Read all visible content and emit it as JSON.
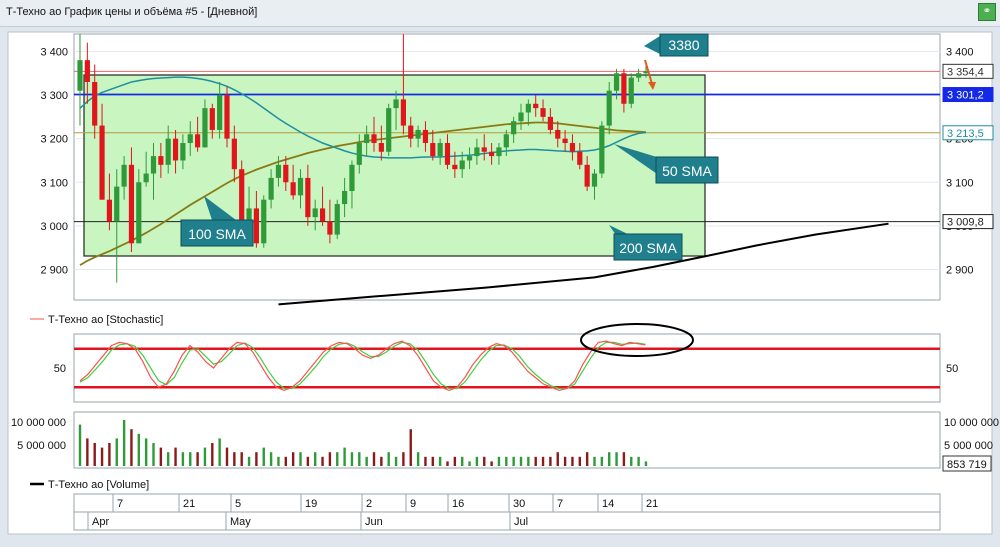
{
  "window": {
    "title": "Т-Техно ао График цены и объёма #5 - [Дневной]"
  },
  "colors": {
    "up": "#2f9a3a",
    "down": "#e0161c",
    "sma50": "#1e8fa0",
    "sma100": "#8a7a14",
    "sma200": "#000000",
    "level": "#1428e8",
    "box": "#c8f5c0",
    "stoch_k": "#ff5050",
    "stoch_d": "#3fcf3f",
    "callout": "#1f7f8c"
  },
  "price_axis": {
    "ticks": [
      "3 400",
      "3 300",
      "3 200",
      "3 100",
      "3 000",
      "2 900"
    ],
    "values": [
      3400,
      3300,
      3200,
      3100,
      3000,
      2900
    ],
    "labels": {
      "close": "3 354,4",
      "level": "3 301,2",
      "sma50": "3 213,5",
      "support": "3 009,8"
    }
  },
  "annotations": {
    "target": "3380",
    "sma50": "50 SMA",
    "sma100": "100 SMA",
    "sma200": "200 SMA"
  },
  "stoch_panel": {
    "legend": "Т-Техно ао [Stochastic]",
    "tick": "50"
  },
  "volume_panel": {
    "legend": "Т-Техно ао [Volume]",
    "ticks": [
      "10 000 000",
      "5 000 000"
    ],
    "right_ticks": [
      "10 000 000",
      "5 000 000"
    ],
    "last_value": "853 719"
  },
  "time_axis": {
    "days": [
      "7",
      "21",
      "5",
      "19",
      "2",
      "9",
      "16",
      "30",
      "7",
      "14",
      "21"
    ],
    "months": [
      "Apr",
      "May",
      "Jun",
      "Jul"
    ]
  },
  "chart_data": {
    "type": "candlestick",
    "title": "Т-Техно ао График цены и объёма #5 - [Дневной]",
    "ylim": [
      2830,
      3440
    ],
    "candles": [
      [
        3310,
        3440,
        3230,
        3380
      ],
      [
        3380,
        3420,
        3280,
        3330
      ],
      [
        3330,
        3370,
        3200,
        3230
      ],
      [
        3230,
        3280,
        3060,
        3060
      ],
      [
        3060,
        3120,
        2990,
        3010
      ],
      [
        3010,
        3130,
        2870,
        3090
      ],
      [
        3090,
        3160,
        3060,
        3140
      ],
      [
        3140,
        3180,
        2940,
        2960
      ],
      [
        2960,
        3130,
        2960,
        3100
      ],
      [
        3100,
        3170,
        3090,
        3120
      ],
      [
        3120,
        3190,
        3060,
        3160
      ],
      [
        3160,
        3190,
        3110,
        3140
      ],
      [
        3140,
        3230,
        3120,
        3200
      ],
      [
        3200,
        3220,
        3120,
        3150
      ],
      [
        3150,
        3210,
        3130,
        3190
      ],
      [
        3190,
        3240,
        3160,
        3210
      ],
      [
        3210,
        3250,
        3170,
        3180
      ],
      [
        3180,
        3290,
        3180,
        3270
      ],
      [
        3270,
        3280,
        3200,
        3220
      ],
      [
        3220,
        3330,
        3200,
        3300
      ],
      [
        3300,
        3320,
        3180,
        3200
      ],
      [
        3200,
        3230,
        3100,
        3130
      ],
      [
        3130,
        3150,
        2980,
        3010
      ],
      [
        3010,
        3090,
        2960,
        3040
      ],
      [
        3040,
        3080,
        2950,
        2960
      ],
      [
        2960,
        3070,
        2950,
        3060
      ],
      [
        3060,
        3130,
        3040,
        3110
      ],
      [
        3110,
        3160,
        3090,
        3140
      ],
      [
        3140,
        3160,
        3080,
        3100
      ],
      [
        3100,
        3140,
        3060,
        3070
      ],
      [
        3070,
        3130,
        3040,
        3110
      ],
      [
        3110,
        3140,
        3000,
        3020
      ],
      [
        3020,
        3060,
        2990,
        3040
      ],
      [
        3040,
        3090,
        3000,
        3010
      ],
      [
        3010,
        3060,
        2960,
        2980
      ],
      [
        2980,
        3060,
        2970,
        3050
      ],
      [
        3050,
        3110,
        3020,
        3080
      ],
      [
        3080,
        3150,
        3040,
        3140
      ],
      [
        3140,
        3210,
        3120,
        3190
      ],
      [
        3190,
        3230,
        3160,
        3210
      ],
      [
        3210,
        3250,
        3170,
        3190
      ],
      [
        3190,
        3230,
        3150,
        3170
      ],
      [
        3170,
        3280,
        3160,
        3270
      ],
      [
        3270,
        3310,
        3220,
        3290
      ],
      [
        3290,
        3440,
        3210,
        3230
      ],
      [
        3230,
        3250,
        3180,
        3200
      ],
      [
        3200,
        3230,
        3180,
        3220
      ],
      [
        3220,
        3240,
        3170,
        3190
      ],
      [
        3190,
        3220,
        3150,
        3160
      ],
      [
        3160,
        3200,
        3140,
        3190
      ],
      [
        3190,
        3210,
        3130,
        3140
      ],
      [
        3140,
        3170,
        3110,
        3130
      ],
      [
        3130,
        3170,
        3110,
        3150
      ],
      [
        3150,
        3180,
        3130,
        3160
      ],
      [
        3160,
        3200,
        3140,
        3180
      ],
      [
        3180,
        3210,
        3150,
        3170
      ],
      [
        3170,
        3190,
        3140,
        3160
      ],
      [
        3160,
        3190,
        3140,
        3180
      ],
      [
        3180,
        3220,
        3160,
        3210
      ],
      [
        3210,
        3250,
        3190,
        3240
      ],
      [
        3240,
        3280,
        3220,
        3260
      ],
      [
        3260,
        3290,
        3230,
        3280
      ],
      [
        3280,
        3300,
        3250,
        3270
      ],
      [
        3270,
        3290,
        3240,
        3250
      ],
      [
        3250,
        3270,
        3210,
        3220
      ],
      [
        3220,
        3240,
        3180,
        3200
      ],
      [
        3200,
        3220,
        3170,
        3190
      ],
      [
        3190,
        3210,
        3150,
        3170
      ],
      [
        3170,
        3190,
        3130,
        3140
      ],
      [
        3140,
        3160,
        3080,
        3090
      ],
      [
        3090,
        3130,
        3060,
        3120
      ],
      [
        3120,
        3240,
        3110,
        3230
      ],
      [
        3230,
        3330,
        3210,
        3310
      ],
      [
        3310,
        3360,
        3290,
        3350
      ],
      [
        3350,
        3360,
        3260,
        3280
      ],
      [
        3280,
        3350,
        3270,
        3340
      ],
      [
        3340,
        3360,
        3330,
        3350
      ],
      [
        3350,
        3370,
        3340,
        3355
      ]
    ],
    "sma50": [
      3270,
      3285,
      3298,
      3306,
      3312,
      3318,
      3324,
      3330,
      3333,
      3336,
      3338,
      3339,
      3340,
      3341,
      3341,
      3340,
      3338,
      3335,
      3331,
      3326,
      3320,
      3312,
      3303,
      3293,
      3282,
      3270,
      3258,
      3246,
      3235,
      3225,
      3215,
      3206,
      3198,
      3190,
      3184,
      3178,
      3172,
      3167,
      3163,
      3160,
      3158,
      3157,
      3156,
      3156,
      3156,
      3156,
      3157,
      3158,
      3158,
      3158,
      3159,
      3160,
      3161,
      3162,
      3164,
      3166,
      3168,
      3170,
      3172,
      3173,
      3174,
      3175,
      3175,
      3174,
      3173,
      3172,
      3171,
      3170,
      3171,
      3172,
      3174,
      3178,
      3184,
      3192,
      3200,
      3207,
      3212,
      3214
    ],
    "sma100": [
      2910,
      2920,
      2928,
      2935,
      2942,
      2950,
      2958,
      2966,
      2975,
      2984,
      2994,
      3004,
      3015,
      3026,
      3037,
      3048,
      3058,
      3068,
      3078,
      3088,
      3098,
      3107,
      3115,
      3122,
      3129,
      3135,
      3141,
      3147,
      3152,
      3157,
      3162,
      3167,
      3171,
      3175,
      3179,
      3183,
      3186,
      3189,
      3192,
      3195,
      3197,
      3199,
      3201,
      3203,
      3205,
      3207,
      3209,
      3211,
      3213,
      3215,
      3217,
      3219,
      3221,
      3223,
      3225,
      3227,
      3229,
      3231,
      3233,
      3234,
      3235,
      3236,
      3237,
      3237,
      3236,
      3235,
      3233,
      3231,
      3229,
      3227,
      3225,
      3223,
      3221,
      3219,
      3218,
      3217,
      3216,
      3215
    ],
    "sma200": [
      [
        27,
        2820
      ],
      [
        40,
        2838
      ],
      [
        55,
        2858
      ],
      [
        70,
        2882
      ],
      [
        78,
        2906
      ],
      [
        85,
        2930
      ],
      [
        92,
        2955
      ],
      [
        100,
        2980
      ],
      [
        110,
        3005
      ]
    ],
    "stochastic": {
      "tick": "50",
      "levels": [
        80,
        20
      ],
      "k": [
        30,
        40,
        55,
        70,
        85,
        90,
        88,
        80,
        60,
        35,
        20,
        25,
        45,
        70,
        85,
        75,
        60,
        50,
        65,
        80,
        90,
        88,
        75,
        55,
        35,
        20,
        15,
        20,
        30,
        45,
        60,
        75,
        85,
        90,
        88,
        80,
        70,
        65,
        70,
        80,
        88,
        92,
        85,
        70,
        50,
        30,
        20,
        15,
        20,
        35,
        55,
        70,
        82,
        88,
        85,
        75,
        60,
        45,
        35,
        25,
        20,
        15,
        18,
        30,
        55,
        75,
        90,
        92,
        88,
        85,
        90,
        88,
        86
      ],
      "d": [
        28,
        35,
        48,
        62,
        78,
        86,
        88,
        84,
        70,
        50,
        30,
        24,
        35,
        58,
        78,
        80,
        68,
        56,
        60,
        72,
        85,
        89,
        82,
        65,
        45,
        28,
        18,
        18,
        25,
        38,
        52,
        68,
        80,
        87,
        89,
        84,
        75,
        68,
        68,
        75,
        84,
        90,
        88,
        78,
        60,
        40,
        25,
        18,
        18,
        28,
        45,
        62,
        76,
        85,
        86,
        80,
        68,
        52,
        40,
        30,
        22,
        18,
        18,
        25,
        45,
        65,
        82,
        90,
        90,
        87,
        88,
        89,
        87
      ]
    },
    "volume": [
      9,
      6,
      5,
      4,
      5,
      6,
      10,
      8,
      7,
      6,
      5,
      4,
      3,
      4,
      3,
      3,
      3,
      4,
      5,
      6,
      4,
      3,
      3,
      2,
      3,
      4,
      3,
      2,
      2,
      3,
      3,
      2,
      3,
      2,
      3,
      3,
      4,
      3,
      3,
      2,
      3,
      2,
      3,
      2,
      3,
      8,
      3,
      2,
      2,
      2,
      1,
      2,
      2,
      1,
      2,
      2,
      1,
      2,
      2,
      2,
      2,
      2,
      2,
      2,
      2,
      3,
      2,
      2,
      2,
      3,
      2,
      2,
      3,
      3,
      3,
      2,
      2,
      1
    ],
    "volume_unit_max": 10000000
  }
}
